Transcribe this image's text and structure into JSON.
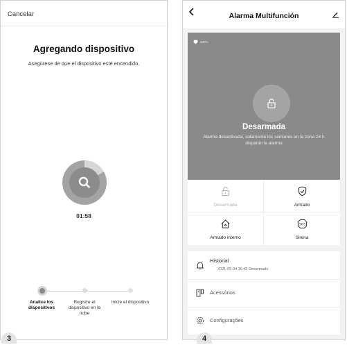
{
  "screen3": {
    "cancel_label": "Cancelar",
    "title": "Agregando dispositivo",
    "subtitle": "Asegúrese de que el dispositivo esté encendido.",
    "timer": "01:58",
    "scan_progress": 0.17,
    "steps": [
      {
        "label": "Analice los dispositivos",
        "active": true
      },
      {
        "label": "Registre el dispositivo en la nube",
        "active": false
      },
      {
        "label": "Inicie el dispositivo",
        "active": false
      }
    ],
    "number_badge": "3"
  },
  "screen4": {
    "title": "Alarma Multifunción",
    "battery_text": "100%",
    "state_title": "Desarmada",
    "state_desc": "Alarma desactivada, solamente los sensores en la zona 24 h disparan la alarma",
    "modes": [
      {
        "label": "Desarmada",
        "icon": "unlock-icon",
        "selected": true
      },
      {
        "label": "Armado",
        "icon": "shield-check-icon",
        "selected": false
      },
      {
        "label": "Armado interno",
        "icon": "home-icon",
        "selected": false
      },
      {
        "label": "Sirena",
        "icon": "sos-icon",
        "selected": false
      }
    ],
    "menu": {
      "history_label": "Historial",
      "history_detail": "2021-05-04 16:45 Desarmado",
      "accessories_label": "Acessórios",
      "settings_label": "Configurações"
    },
    "number_badge": "4"
  },
  "colors": {
    "panel_gray": "#8a8a8a",
    "page_background": "#ffffff",
    "disabled_text": "#b5b5b5"
  }
}
